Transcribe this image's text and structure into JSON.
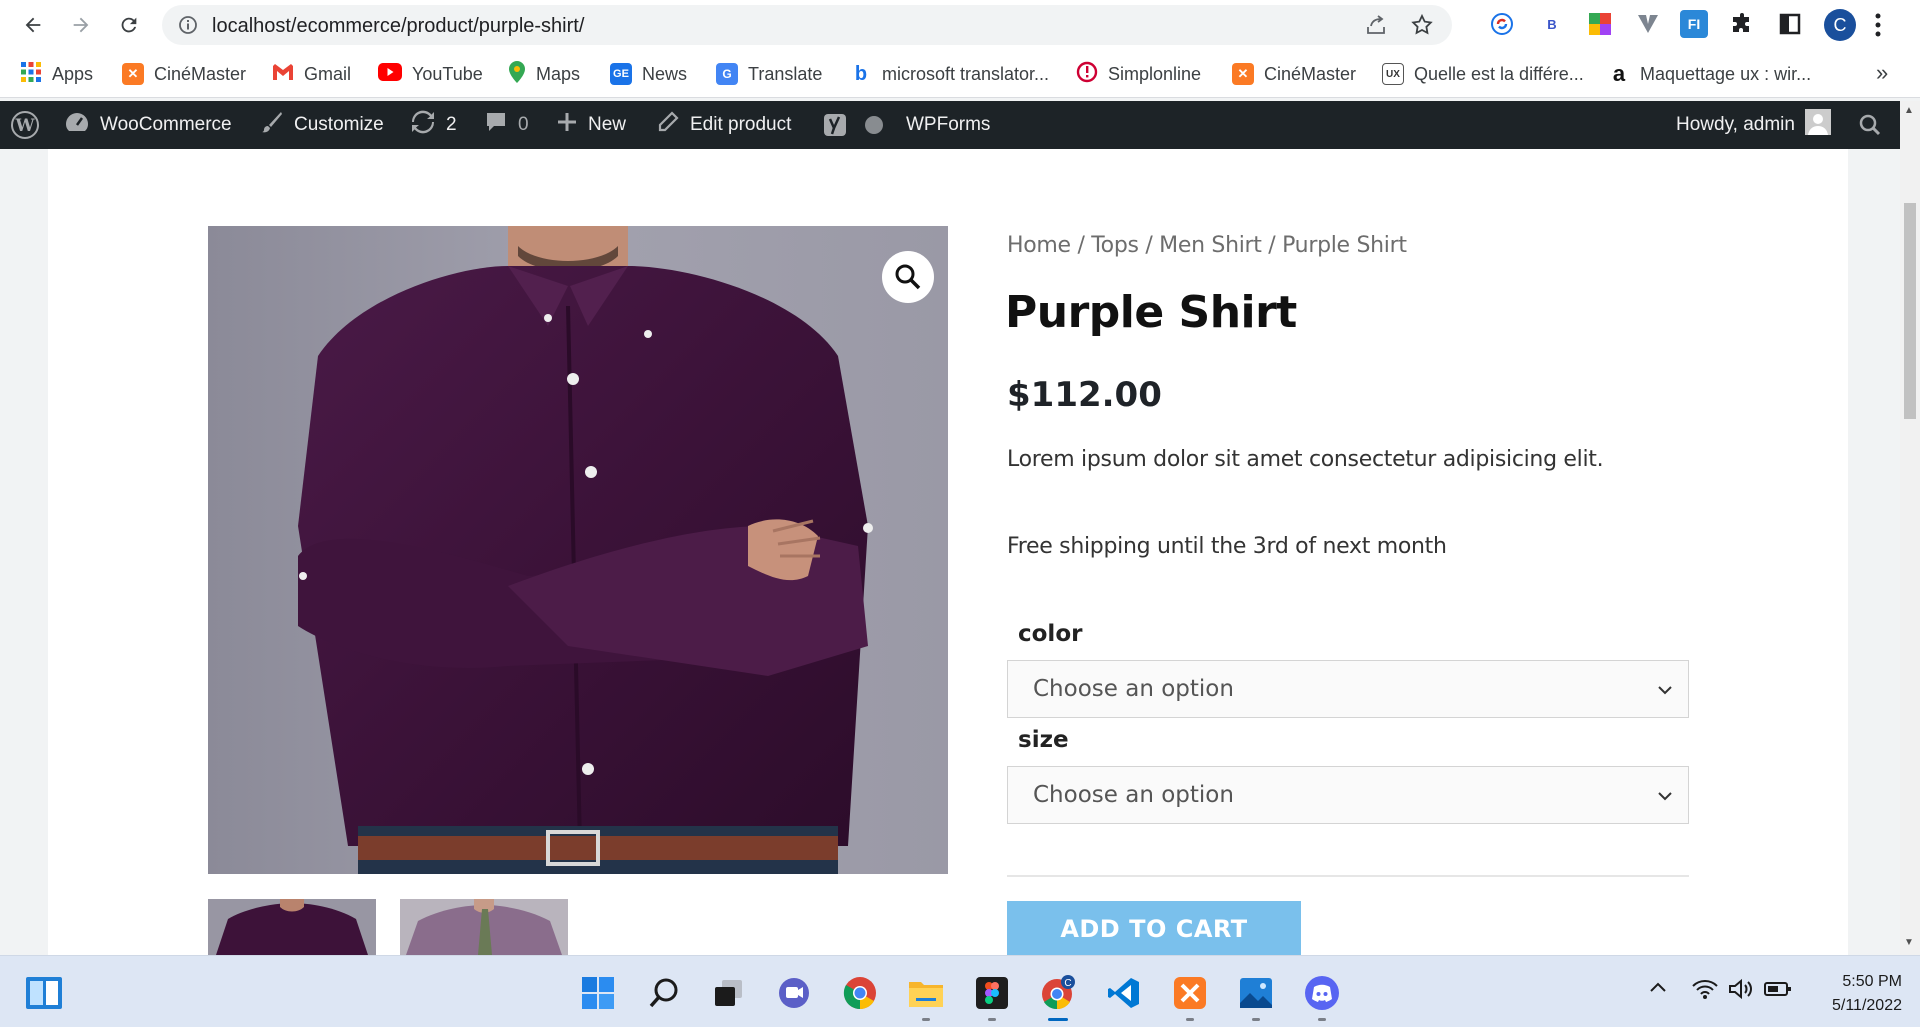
{
  "browser": {
    "url": "localhost/ecommerce/product/purple-shirt/",
    "profile_initial": "C",
    "extensions": [
      "sync-extension-icon",
      "bing-b-icon",
      "color-picker-icon",
      "vuetify-v-icon",
      "fi-icon",
      "puzzle-icon",
      "sidebar-icon"
    ]
  },
  "bookmarks": {
    "items": [
      {
        "label": "Apps",
        "icon": "apps-grid-icon"
      },
      {
        "label": "CinéMaster",
        "icon": "xampp-icon"
      },
      {
        "label": "Gmail",
        "icon": "gmail-icon"
      },
      {
        "label": "YouTube",
        "icon": "youtube-icon"
      },
      {
        "label": "Maps",
        "icon": "maps-pin-icon"
      },
      {
        "label": "News",
        "icon": "news-icon"
      },
      {
        "label": "Translate",
        "icon": "translate-icon"
      },
      {
        "label": "microsoft translator...",
        "icon": "bing-icon"
      },
      {
        "label": "Simplonline",
        "icon": "simplonline-icon"
      },
      {
        "label": "CinéMaster",
        "icon": "xampp-icon"
      },
      {
        "label": "Quelle est la différe...",
        "icon": "blog-ux-icon"
      },
      {
        "label": "Maquettage ux : wir...",
        "icon": "amazon-a-icon"
      }
    ],
    "more": "»"
  },
  "adminbar": {
    "woocommerce": "WooCommerce",
    "customize": "Customize",
    "updates": "2",
    "comments": "0",
    "new": "New",
    "edit_product": "Edit product",
    "wpforms": "WPForms",
    "howdy": "Howdy, admin"
  },
  "product": {
    "breadcrumb": "Home / Tops / Men Shirt / Purple Shirt",
    "title": "Purple Shirt",
    "price": "$112.00",
    "description": "Lorem ipsum dolor sit amet consectetur adipisicing elit.",
    "shipping": "Free shipping until the 3rd of next month",
    "color_label": "color",
    "color_select": "Choose an option",
    "size_label": "size",
    "size_select": "Choose an option",
    "add_to_cart": "ADD TO CART"
  },
  "taskbar": {
    "time": "5:50 PM",
    "date": "5/11/2022",
    "apps": [
      "widgets-icon",
      "windows-start-icon",
      "search-icon",
      "task-view-icon",
      "teams-chat-icon",
      "chrome-icon",
      "file-explorer-icon",
      "figma-icon",
      "chrome-profile-icon",
      "vscode-icon",
      "xampp-icon",
      "photos-icon",
      "discord-icon"
    ]
  }
}
